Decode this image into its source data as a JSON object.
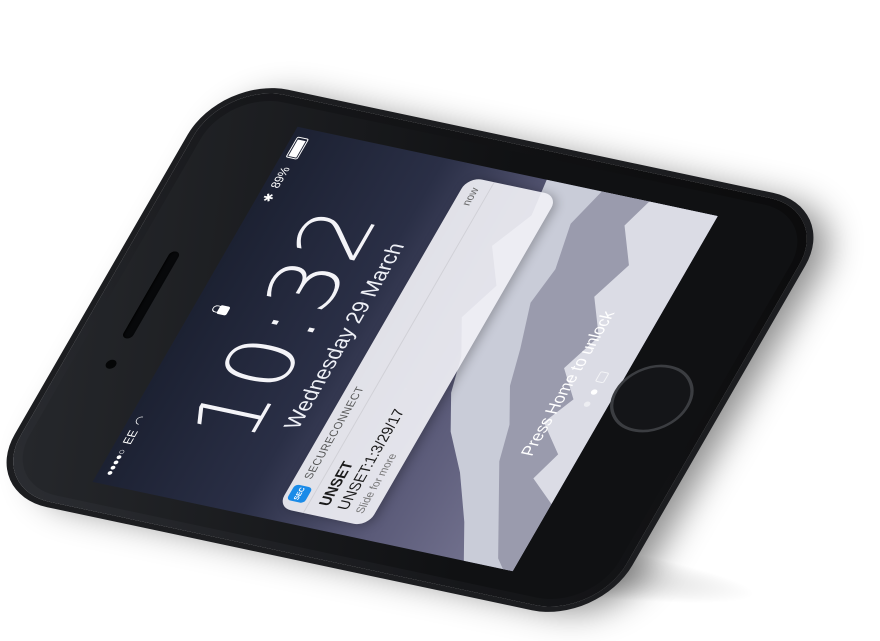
{
  "status_bar": {
    "carrier": "EE",
    "signal": "●●●●○",
    "bluetooth": "✱",
    "battery_percent": "89%"
  },
  "lockscreen": {
    "time": "10:32",
    "date": "Wednesday 29 March",
    "unlock_hint": "Press Home to unlock"
  },
  "notification": {
    "app_name": "SECURECONNECT",
    "app_icon_text": "SEC",
    "time": "now",
    "title": "UNSET",
    "message": "UNSET:1:3/29/17",
    "hint": "Slide for more"
  },
  "colors": {
    "app_icon": "#1a8be8",
    "phone_body": "#16171a"
  }
}
